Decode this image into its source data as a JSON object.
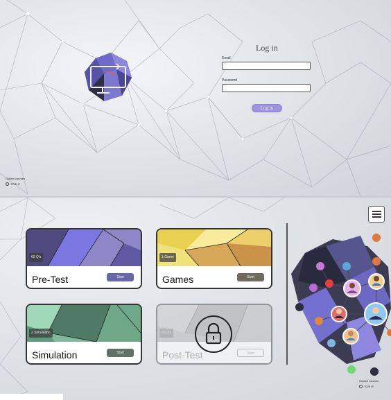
{
  "login": {
    "title": "Log in",
    "email_label": "Email",
    "password_label": "Password",
    "button_label": "Log in"
  },
  "brand": {
    "tagline": "Guided courses",
    "name": "TCRI IF"
  },
  "cards": {
    "pretest": {
      "title": "Pre-Test",
      "badge": "60 Q's",
      "start": "Start"
    },
    "games": {
      "title": "Games",
      "badge": "1 Game",
      "start": "Start"
    },
    "simulation": {
      "title": "Simulation",
      "badge": "2 Simulation",
      "start": "Start"
    },
    "posttest": {
      "title": "Post-Test",
      "badge": "60 Q's",
      "start": "Start"
    }
  },
  "icons": [
    "monitor-logo-icon",
    "lock-icon",
    "hamburger-menu-icon",
    "network-avatars-icon"
  ],
  "colors": {
    "accent": "#9f92e0",
    "start_pretest": "#6a67a8",
    "start_games": "#6f6b5e",
    "start_sim": "#5e7268"
  }
}
